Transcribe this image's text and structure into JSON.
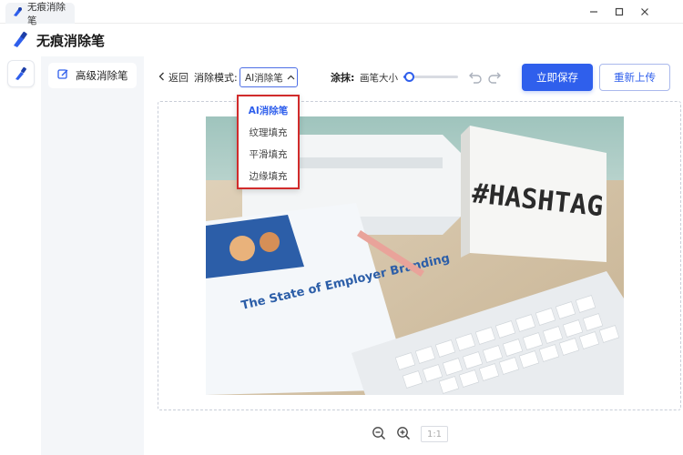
{
  "window": {
    "tab_title": "无痕消除笔",
    "app_title": "无痕消除笔"
  },
  "sidebar": {
    "items": [
      {
        "label": "高级消除笔",
        "icon": "edit-icon"
      }
    ]
  },
  "toolbar": {
    "back_label": "返回",
    "mode_label": "消除模式:",
    "mode_value": "AI消除笔",
    "smear_label": "涂抹:",
    "brush_label": "画笔大小",
    "brush_size": 0.08,
    "save_label": "立即保存",
    "reupload_label": "重新上传"
  },
  "dropdown": {
    "options": [
      "AI消除笔",
      "纹理填充",
      "平滑填充",
      "边缘填充"
    ],
    "selected_index": 0
  },
  "zoom": {
    "ratio_label": "1:1"
  },
  "colors": {
    "accent": "#2f5fec",
    "highlight_border": "#d12b2b"
  },
  "photo": {
    "lightbox_text": "#HASHTAG",
    "booklet_title": "The State of Employer Branding"
  }
}
